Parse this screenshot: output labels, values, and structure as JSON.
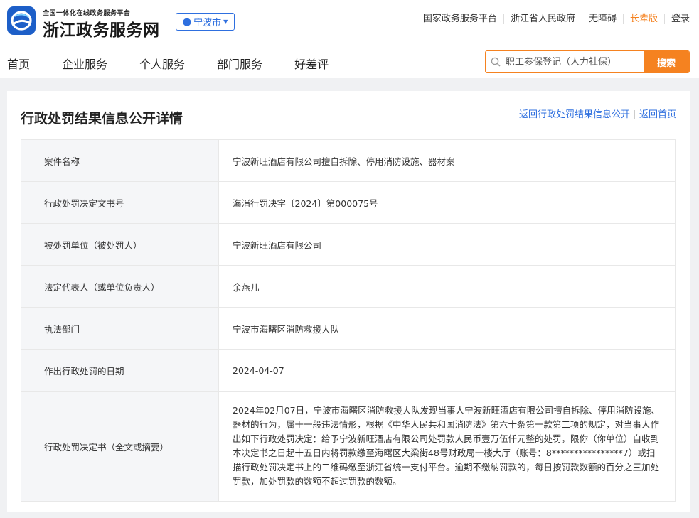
{
  "header": {
    "subtitle": "全国一体化在线政务服务平台",
    "title": "浙江政务服务网",
    "city": "宁波市",
    "top_links": [
      "国家政务服务平台",
      "浙江省人民政府",
      "无障碍",
      "长辈版",
      "登录"
    ],
    "accent_color": "#f58220",
    "brand_color": "#1d5fc8"
  },
  "nav": {
    "items": [
      "首页",
      "企业服务",
      "个人服务",
      "部门服务",
      "好差评"
    ]
  },
  "search": {
    "placeholder": "职工参保登记（人力社保）",
    "button_label": "搜索"
  },
  "page": {
    "title": "行政处罚结果信息公开详情",
    "links": [
      "返回行政处罚结果信息公开",
      "返回首页"
    ]
  },
  "rows": [
    {
      "label": "案件名称",
      "value": "宁波新旺酒店有限公司擅自拆除、停用消防设施、器材案"
    },
    {
      "label": "行政处罚决定文书号",
      "value": "海消行罚决字〔2024〕第000075号"
    },
    {
      "label": "被处罚单位（被处罚人）",
      "value": "宁波新旺酒店有限公司"
    },
    {
      "label": "法定代表人（或单位负责人）",
      "value": "余燕儿"
    },
    {
      "label": "执法部门",
      "value": "宁波市海曙区消防救援大队"
    },
    {
      "label": "作出行政处罚的日期",
      "value": "2024-04-07"
    },
    {
      "label": "行政处罚决定书（全文或摘要）",
      "value": "2024年02月07日，宁波市海曙区消防救援大队发现当事人宁波新旺酒店有限公司擅自拆除、停用消防设施、器材的行为，属于一般违法情形，根据《中华人民共和国消防法》第六十条第一款第二项的规定，对当事人作出如下行政处罚决定：给予宁波新旺酒店有限公司处罚款人民币壹万伍仟元整的处罚，限你（你单位）自收到本决定书之日起十五日内将罚款缴至海曙区大梁街48号财政局一楼大厅（账号：8****************7）或扫描行政处罚决定书上的二维码缴至浙江省统一支付平台。逾期不缴纳罚款的，每日按罚款数额的百分之三加处罚款，加处罚款的数额不超过罚款的数额。"
    }
  ]
}
